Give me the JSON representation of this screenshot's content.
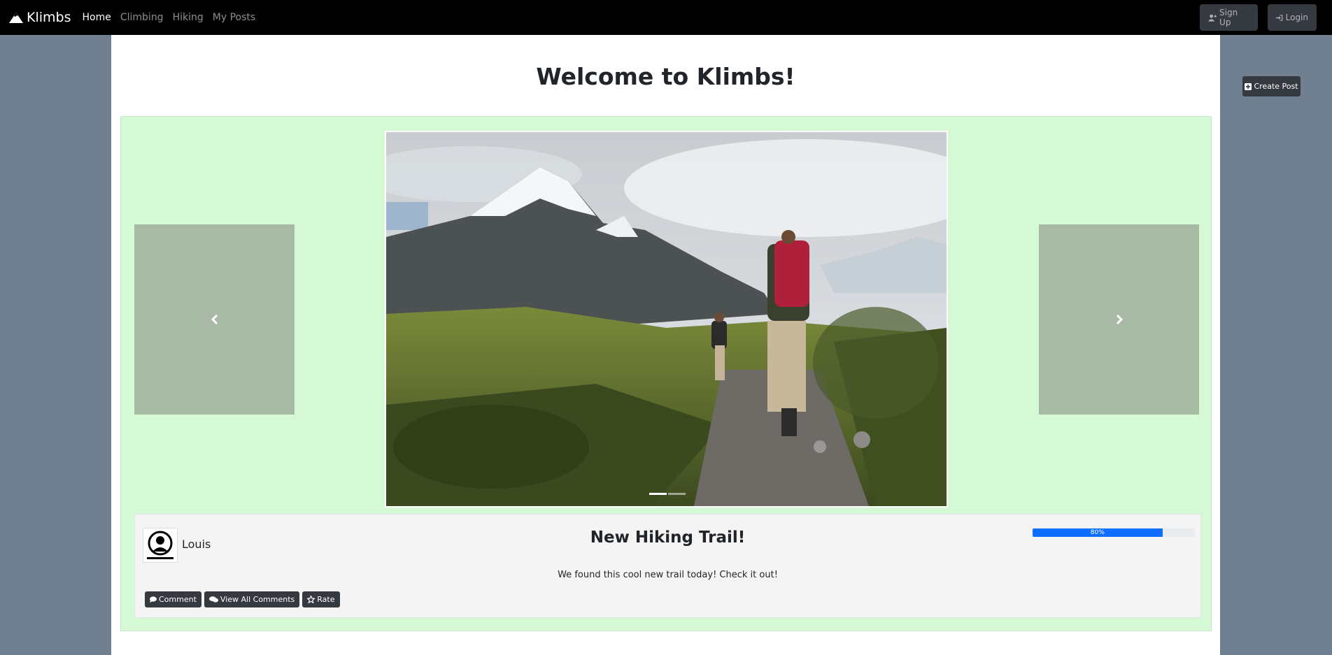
{
  "nav": {
    "brand": "Klimbs",
    "links": [
      {
        "label": "Home",
        "active": true
      },
      {
        "label": "Climbing",
        "active": false
      },
      {
        "label": "Hiking",
        "active": false
      },
      {
        "label": "My Posts",
        "active": false
      }
    ],
    "signup": "Sign Up",
    "login": "Login"
  },
  "page": {
    "title": "Welcome to Klimbs!",
    "create_post": "Create Post"
  },
  "post": {
    "author": "Louis",
    "title": "New Hiking Trail!",
    "description": "We found this cool new trail today! Check it out!",
    "rating_percent": 80,
    "rating_label": "80%",
    "carousel_slides": 2,
    "active_slide": 1,
    "buttons": {
      "comment": "Comment",
      "view_all": "View All Comments",
      "rate": "Rate"
    }
  },
  "colors": {
    "background": "#708090",
    "navbar": "#000000",
    "post_bg": "#d5f8d5",
    "button_dark": "#343a40",
    "progress": "#0d6efd"
  },
  "icons": [
    "mountain-icon",
    "user-plus-icon",
    "sign-in-icon",
    "plus-square-icon",
    "chevron-left-icon",
    "chevron-right-icon",
    "user-icon",
    "comment-icon",
    "comments-icon",
    "star-icon"
  ]
}
